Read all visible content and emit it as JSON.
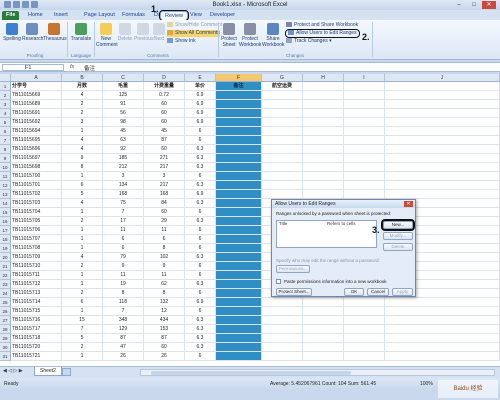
{
  "window": {
    "title": "Book1.xlsx - Microsoft Excel",
    "min": "–",
    "max": "□",
    "close": "✕"
  },
  "tabs": [
    "File",
    "Home",
    "Insert",
    "Page Layout",
    "Formulas",
    "Data",
    "Review",
    "View",
    "Developer"
  ],
  "ribbon": {
    "spelling": "Spelling",
    "research": "Research",
    "thesaurus": "Thesaurus",
    "translate": "Translate",
    "new_comment": "New Comment",
    "delete": "Delete",
    "previous": "Previous",
    "next": "Next",
    "show_hide_comment": "Show/Hide Comment",
    "show_all_comments": "Show All Comments",
    "show_ink": "Show Ink",
    "protect_sheet": "Protect Sheet",
    "protect_workbook": "Protect Workbook",
    "share_workbook": "Share Workbook",
    "protect_and_share": "Protect and Share Workbook",
    "allow_users": "Allow Users to Edit Ranges",
    "track_changes": "Track Changes ▾",
    "groups": {
      "proofing": "Proofing",
      "language": "Language",
      "comments": "Comments",
      "changes": "Changes"
    }
  },
  "steps": {
    "one": "1.",
    "two": "2.",
    "three": "3."
  },
  "formula_bar": {
    "name_box": "F1",
    "fx": "fx",
    "value": "备注"
  },
  "columns": [
    "A",
    "B",
    "C",
    "D",
    "E",
    "F",
    "G",
    "H",
    "I",
    "J"
  ],
  "headers": [
    "分学号",
    "月数",
    "毛重",
    "计费重量",
    "单价",
    "备注",
    "航空运费"
  ],
  "rows": [
    [
      "TB11015669",
      "4",
      "125",
      "0.72",
      "6.9"
    ],
    [
      "TB11015689",
      "2",
      "91",
      "60",
      "6.9"
    ],
    [
      "TB11015691",
      "2",
      "56",
      "60",
      "6.9"
    ],
    [
      "TB11015692",
      "3",
      "98",
      "60",
      "6.9"
    ],
    [
      "TB11015694",
      "1",
      "45",
      "45",
      "6"
    ],
    [
      "TB11015695",
      "4",
      "63",
      "87",
      "6"
    ],
    [
      "TB11015696",
      "4",
      "92",
      "60",
      "6.3"
    ],
    [
      "TB11015697",
      "9",
      "185",
      "271",
      "6.3"
    ],
    [
      "TB11015698",
      "8",
      "212",
      "217",
      "6.3"
    ],
    [
      "TB11015700",
      "1",
      "3",
      "3",
      "6"
    ],
    [
      "TB11015701",
      "6",
      "134",
      "217",
      "6.3"
    ],
    [
      "TB11015702",
      "5",
      "168",
      "168",
      "6.9"
    ],
    [
      "TB11015703",
      "4",
      "75",
      "84",
      "6.3"
    ],
    [
      "TB11015704",
      "1",
      "7",
      "60",
      "6"
    ],
    [
      "TB11015705",
      "2",
      "17",
      "29",
      "6.3"
    ],
    [
      "TB11015706",
      "1",
      "11",
      "11",
      "6"
    ],
    [
      "TB11015707",
      "1",
      "6",
      "6",
      "6"
    ],
    [
      "TB11015708",
      "1",
      "6",
      "8",
      "6"
    ],
    [
      "TB11015709",
      "4",
      "79",
      "102",
      "6.3"
    ],
    [
      "TB11015710",
      "2",
      "9",
      "9",
      "6"
    ],
    [
      "TB11015711",
      "1",
      "11",
      "11",
      "6"
    ],
    [
      "TB11015712",
      "1",
      "19",
      "62",
      "6.3"
    ],
    [
      "TB11015713",
      "2",
      "8",
      "8",
      "6"
    ],
    [
      "TB11015714",
      "6",
      "118",
      "132",
      "6.9"
    ],
    [
      "TB11015715",
      "1",
      "7",
      "12",
      "6"
    ],
    [
      "TB11015716",
      "15",
      "348",
      "434",
      "6.3"
    ],
    [
      "TB11015717",
      "7",
      "129",
      "153",
      "6.3"
    ],
    [
      "TB11015718",
      "5",
      "87",
      "87",
      "6.3"
    ],
    [
      "TB11015720",
      "2",
      "47",
      "60",
      "6.3"
    ],
    [
      "TB11015721",
      "1",
      "26",
      "26",
      "6"
    ]
  ],
  "dialog": {
    "title": "Allow Users to Edit Ranges",
    "caption": "Ranges unlocked by a password when sheet is protected:",
    "col_title": "Title",
    "col_refers": "Refers to cells",
    "new_btn": "New...",
    "modify_btn": "Modify...",
    "delete_btn": "Delete",
    "no_password": "Specify who may edit the range without a password:",
    "permissions_btn": "Permissions...",
    "paste_perm": "Paste permissions information into a new workbook",
    "protect_sheet_btn": "Protect Sheet...",
    "ok_btn": "OK",
    "cancel_btn": "Cancel",
    "apply_btn": "Apply",
    "close": "✕"
  },
  "sheet_tab": "Sheet2",
  "status": {
    "ready": "Ready",
    "stats": "Average: 5.452067961   Count: 104   Sum: 561.45",
    "zoom": "100%"
  },
  "watermark": "Baidu 经验"
}
